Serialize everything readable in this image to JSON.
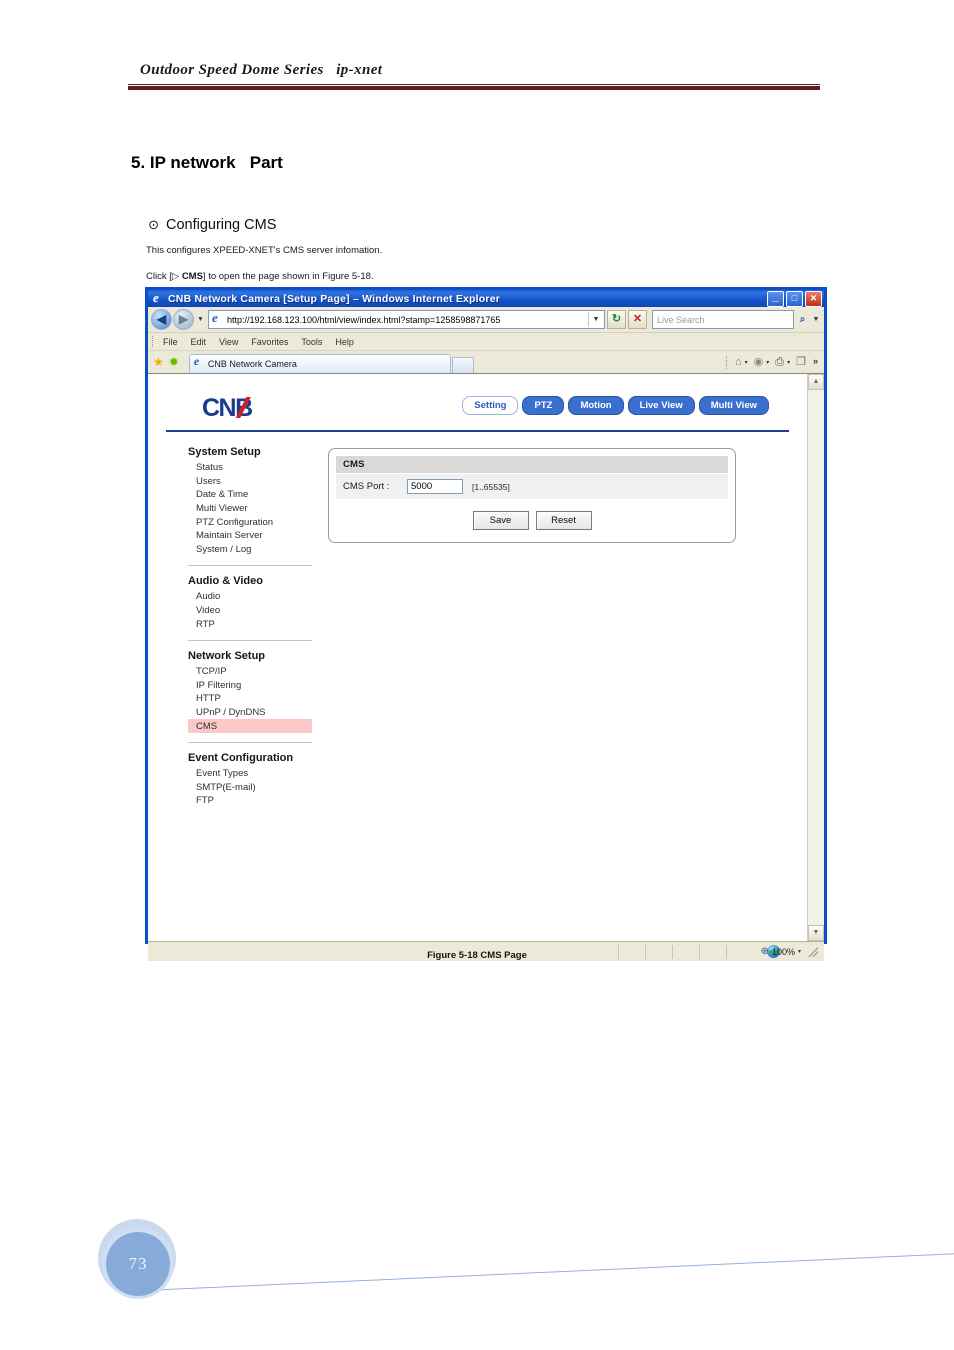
{
  "document": {
    "running_header": "Outdoor Speed Dome Series   ip-xnet",
    "section_title": "5. IP network   Part",
    "subsection_bullet": "⊙",
    "subsection_title": "Configuring CMS",
    "paragraph_1": "This configures XPEED-XNET's CMS server infomation.",
    "paragraph_2_pre": "Click [▷ ",
    "paragraph_2_bold": "CMS",
    "paragraph_2_post": "] to open the page shown in Figure 5-18.",
    "figure_caption": "Figure 5-18 CMS Page",
    "page_number": "73"
  },
  "browser": {
    "window_title": "CNB Network Camera [Setup Page] – Windows Internet Explorer",
    "window_buttons": {
      "minimize": "_",
      "maximize": "□",
      "close": "✕"
    },
    "navigation": {
      "back": "◀",
      "forward": "▶",
      "history_caret": "▼",
      "refresh": "↻",
      "stop": "✕"
    },
    "address": {
      "url": "http://192.168.123.100/html/view/index.html?stamp=1258598871765",
      "dropdown_caret": "▼"
    },
    "search": {
      "placeholder": "Live Search",
      "go_icon": "⌕",
      "caret": "▼"
    },
    "menu_items": [
      "File",
      "Edit",
      "View",
      "Favorites",
      "Tools",
      "Help"
    ],
    "favorites": {
      "favorites_star": "★",
      "add_star": "✹"
    },
    "tab": {
      "label": "CNB Network Camera"
    },
    "command_bar": {
      "home_icon": "⌂",
      "feeds_icon": "◉",
      "print_icon": "⎙",
      "page_icon": "❐",
      "caret": "▾",
      "overflow": "»"
    },
    "statusbar": {
      "zone_label": "",
      "zoom_level": "100%",
      "zoom_icon": "⊕",
      "zoom_caret": "▾"
    },
    "scrollbar": {
      "up_arrow": "▲",
      "down_arrow": "▼"
    }
  },
  "webpage": {
    "logo_text": "CNB",
    "nav_buttons": [
      {
        "label": "Setting",
        "active": true
      },
      {
        "label": "PTZ",
        "active": false
      },
      {
        "label": "Motion",
        "active": false
      },
      {
        "label": "Live View",
        "active": false
      },
      {
        "label": "Multi View",
        "active": false
      }
    ],
    "sidebar": [
      {
        "heading": "System Setup",
        "items": [
          "Status",
          "Users",
          "Date & Time",
          "Multi Viewer",
          "PTZ Configuration",
          "Maintain Server",
          "System / Log"
        ]
      },
      {
        "heading": "Audio & Video",
        "items": [
          "Audio",
          "Video",
          "RTP"
        ]
      },
      {
        "heading": "Network Setup",
        "items": [
          "TCP/IP",
          "IP Filtering",
          "HTTP",
          "UPnP / DynDNS",
          "CMS"
        ],
        "selected": "CMS"
      },
      {
        "heading": "Event Configuration",
        "items": [
          "Event Types",
          "SMTP(E-mail)",
          "FTP"
        ]
      }
    ],
    "panel": {
      "title": "CMS",
      "port_label": "CMS Port :",
      "port_value": "5000",
      "port_range_hint": "[1..65535]",
      "save_label": "Save",
      "reset_label": "Reset"
    }
  },
  "colors": {
    "header_rule": "#5e1f22",
    "logo_blue": "#1c3a8e",
    "logo_red": "#cf2027",
    "nav_button_blue": "#3a6fd0",
    "selected_menu_pink": "#fbc8c8",
    "title_bar_blue": "#1452c8",
    "page_circle_blue": "#87abd8"
  }
}
